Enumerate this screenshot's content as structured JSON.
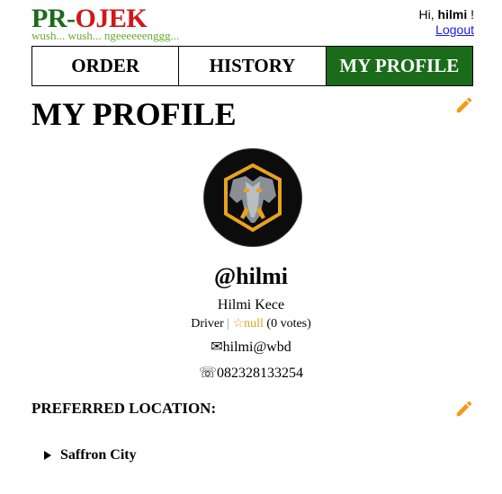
{
  "header": {
    "logo_pr": "PR",
    "logo_dash": "-",
    "logo_ojek": "OJEK",
    "tagline": "wush... wush... ngeeeeeenggg...",
    "greeting_prefix": "Hi, ",
    "greeting_name": "hilmi",
    "greeting_suffix": " !",
    "logout_label": "Logout"
  },
  "nav": {
    "tabs": [
      {
        "label": "ORDER"
      },
      {
        "label": "HISTORY"
      },
      {
        "label": "MY PROFILE"
      }
    ],
    "active_tab": "MY PROFILE",
    "accent_color": "#1a6b1a"
  },
  "profile": {
    "title": "MY PROFILE",
    "username": "@hilmi",
    "full_name": "Hilmi Kece",
    "role": "Driver",
    "separator": "|",
    "rating": "☆null",
    "votes": "(0 votes)",
    "email_icon": "envelope-icon",
    "email": "hilmi@wbd",
    "phone_icon": "phone-icon",
    "phone": "082328133254",
    "avatar_icon": "elephant-shield-avatar",
    "edit_icon": "pencil-icon"
  },
  "preferred_location": {
    "label": "PREFERRED LOCATION:",
    "items": [
      {
        "name": "Saffron City"
      }
    ]
  }
}
